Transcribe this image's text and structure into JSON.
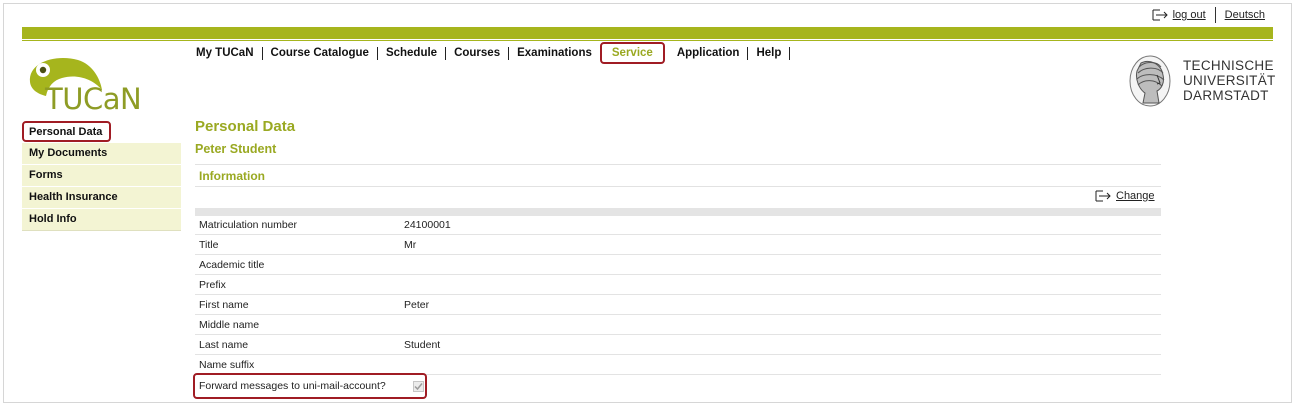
{
  "top_links": {
    "logout": "log out",
    "language": "Deutsch"
  },
  "logo": {
    "text": "TUCaN"
  },
  "main_nav": [
    {
      "label": "My TUCaN",
      "active": false
    },
    {
      "label": "Course Catalogue",
      "active": false
    },
    {
      "label": "Schedule",
      "active": false
    },
    {
      "label": "Courses",
      "active": false
    },
    {
      "label": "Examinations",
      "active": false
    },
    {
      "label": "Service",
      "active": true
    },
    {
      "label": "Application",
      "active": false
    },
    {
      "label": "Help",
      "active": false
    }
  ],
  "university": {
    "line1": "TECHNISCHE",
    "line2": "UNIVERSITÄT",
    "line3": "DARMSTADT"
  },
  "sidebar": {
    "items": [
      {
        "label": "Personal Data",
        "active": true
      },
      {
        "label": "My Documents",
        "active": false
      },
      {
        "label": "Forms",
        "active": false
      },
      {
        "label": "Health Insurance",
        "active": false
      },
      {
        "label": "Hold Info",
        "active": false
      }
    ]
  },
  "content": {
    "page_title": "Personal Data",
    "person_name": "Peter Student",
    "section_title": "Information",
    "change_label": "Change",
    "rows": [
      {
        "label": "Matriculation number",
        "value": "24100001"
      },
      {
        "label": "Title",
        "value": "Mr"
      },
      {
        "label": "Academic title",
        "value": ""
      },
      {
        "label": "Prefix",
        "value": ""
      },
      {
        "label": "First name",
        "value": "Peter"
      },
      {
        "label": "Middle name",
        "value": ""
      },
      {
        "label": "Last name",
        "value": "Student"
      },
      {
        "label": "Name suffix",
        "value": ""
      }
    ],
    "forward_label": "Forward messages to uni-mail-account?",
    "forward_checked": true
  },
  "colors": {
    "accent": "#a6b51d",
    "highlight": "#a01c24",
    "sidebar_bg": "#f3f4d3"
  }
}
